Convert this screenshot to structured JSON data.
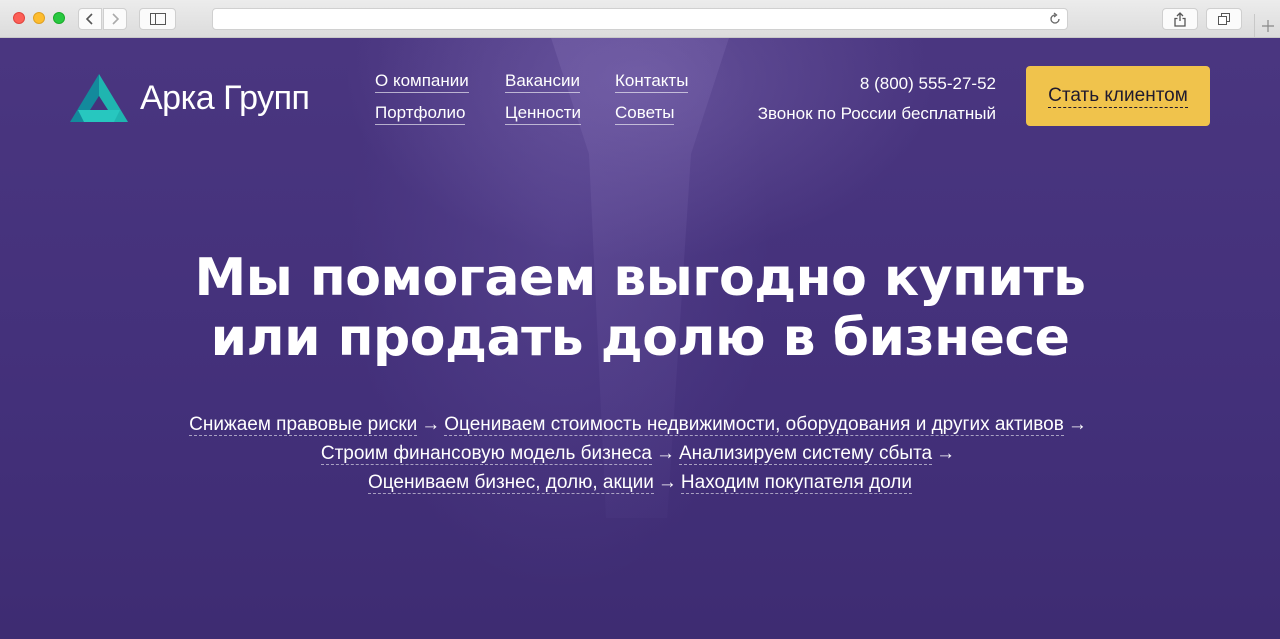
{
  "browser": {
    "address_value": ""
  },
  "header": {
    "logo_text": "Арка Групп",
    "menu": [
      {
        "label": "О компании"
      },
      {
        "label": "Вакансии"
      },
      {
        "label": "Контакты"
      },
      {
        "label": "Портфолио"
      },
      {
        "label": "Ценности"
      },
      {
        "label": "Советы"
      }
    ],
    "phone": "8 (800) 555-27-52",
    "phone_note": "Звонок по России бесплатный",
    "cta_label": "Стать клиентом"
  },
  "hero": {
    "headline_line1": "Мы помогаем выгодно купить",
    "headline_line2": "или продать долю в бизнесе",
    "arrow": "→",
    "steps": [
      "Снижаем правовые риски",
      "Оцениваем стоимость недвижимости, оборудования и других активов",
      "Строим финансовую модель бизнеса",
      "Анализируем систему сбыта",
      "Оцениваем бизнес, долю, акции",
      "Находим покупателя доли"
    ]
  },
  "colors": {
    "background": "#45327c",
    "cta": "#f0c34c",
    "logo_teal": "#1fb5b0"
  }
}
